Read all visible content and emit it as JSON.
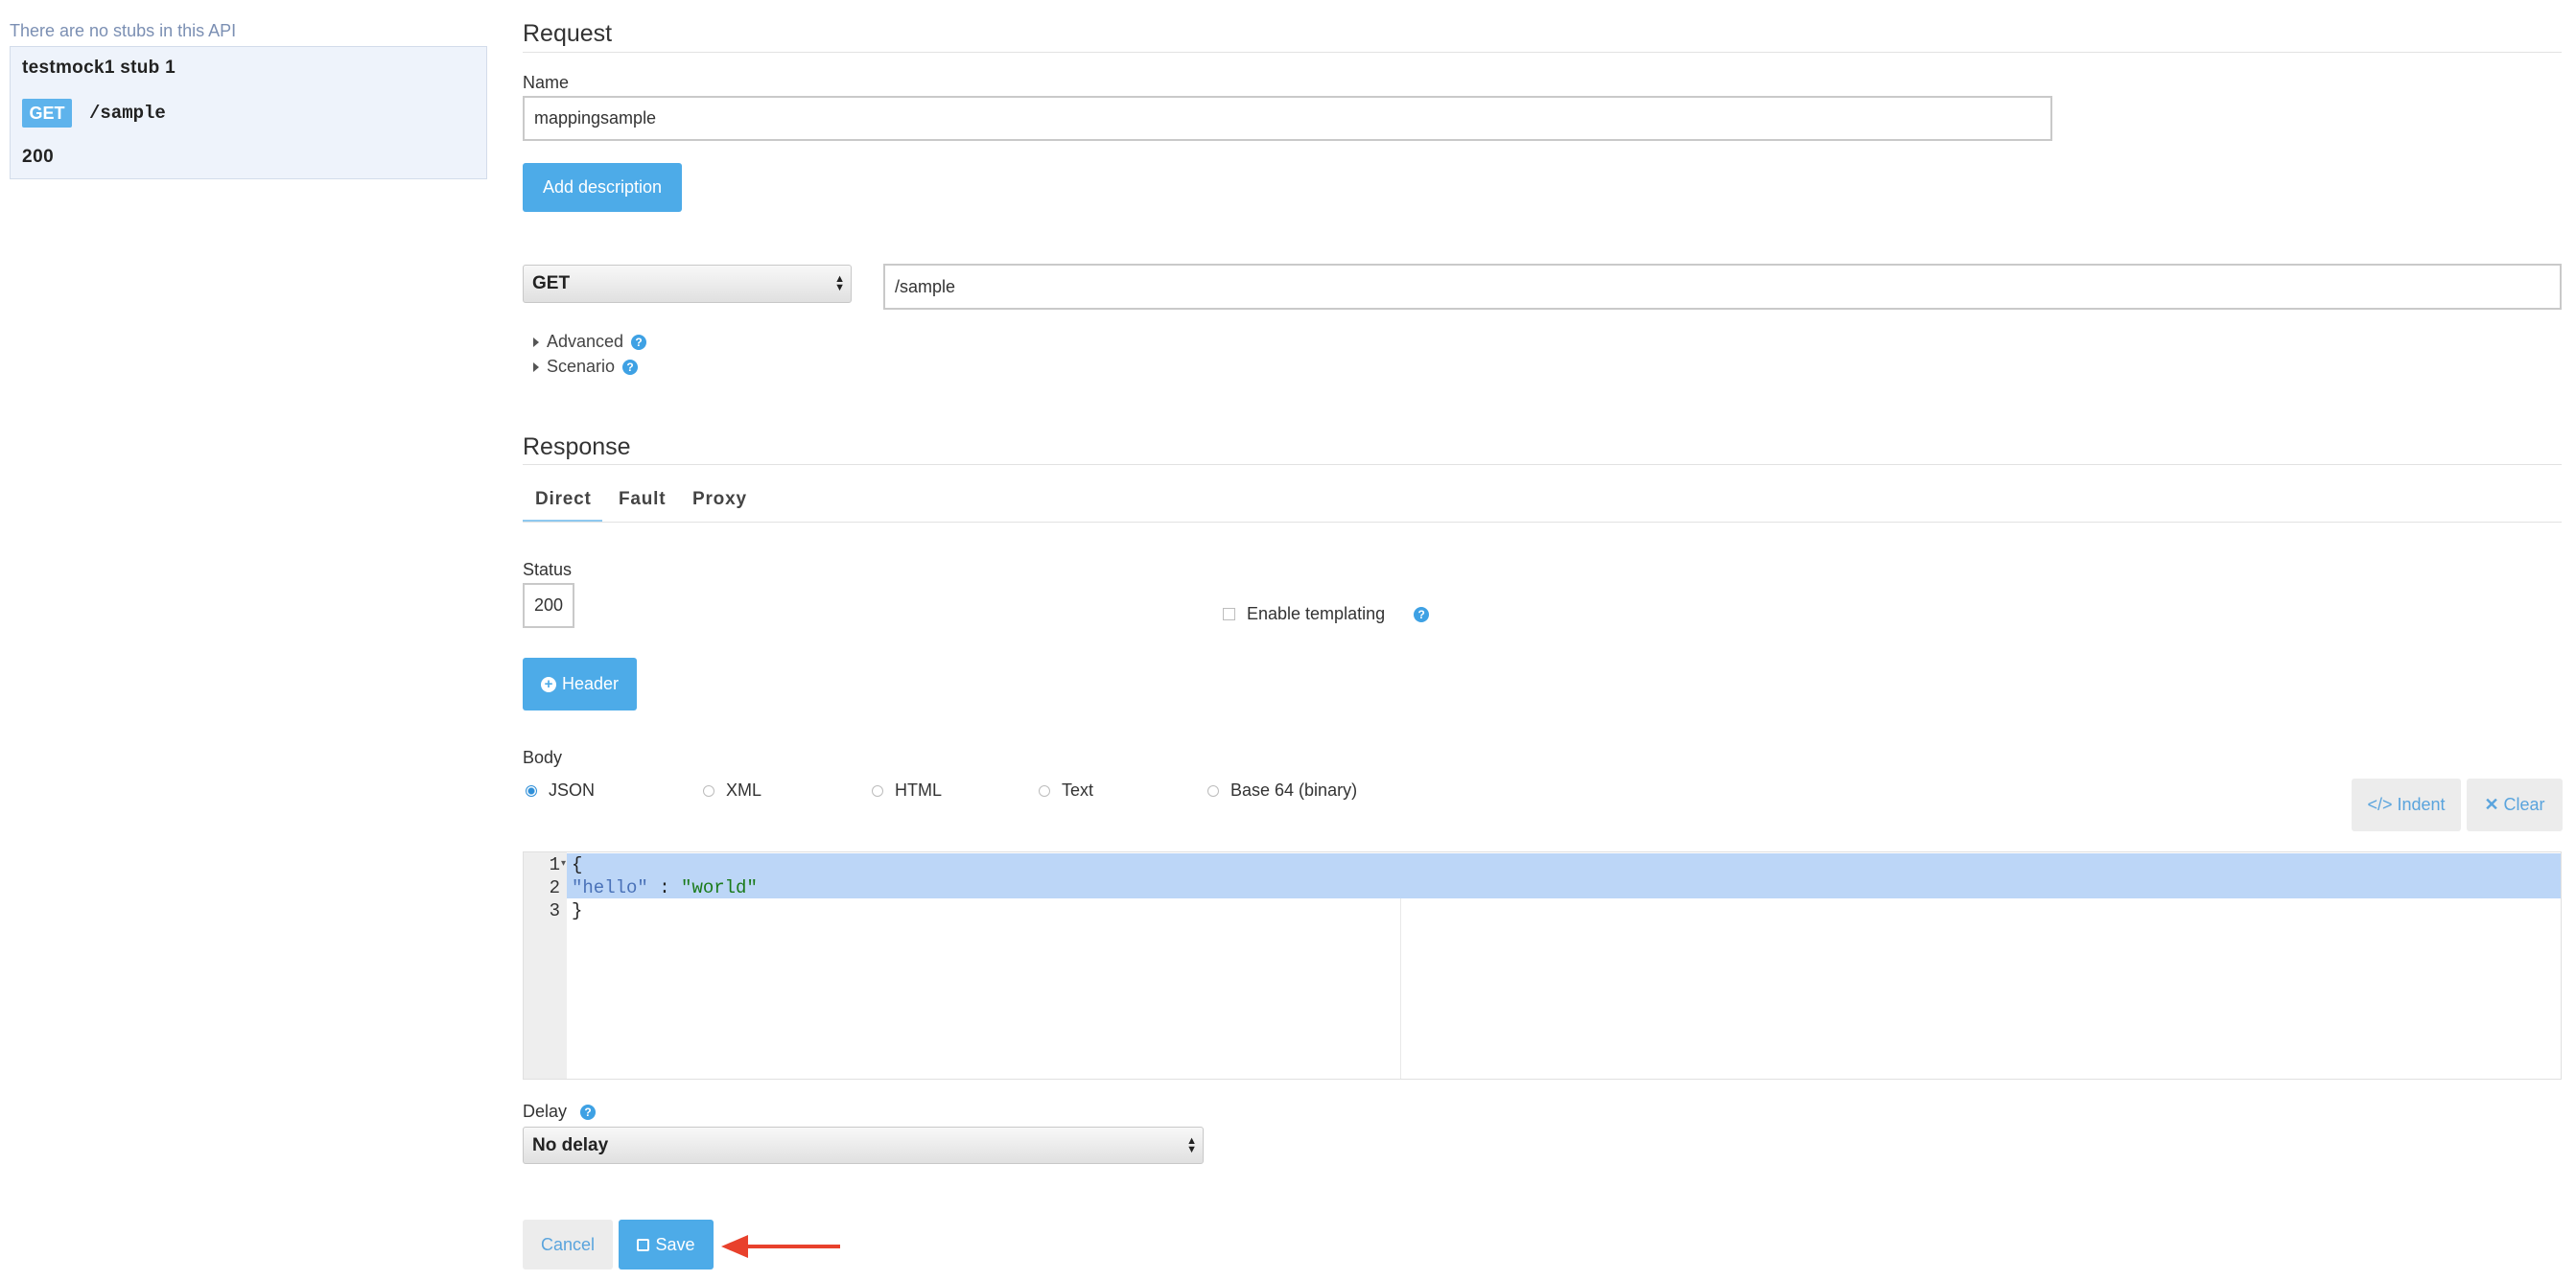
{
  "sidebar": {
    "message": "There are no stubs in this API",
    "stub": {
      "name": "testmock1 stub 1",
      "method": "GET",
      "url": "/sample",
      "status": "200"
    }
  },
  "request": {
    "title": "Request",
    "name_label": "Name",
    "name_value": "mappingsample",
    "add_description": "Add description",
    "method": "GET",
    "url": "/sample",
    "advanced": "Advanced",
    "scenario": "Scenario"
  },
  "response": {
    "title": "Response",
    "tabs": [
      "Direct",
      "Fault",
      "Proxy"
    ],
    "active_tab": "Direct",
    "status_label": "Status",
    "status_value": "200",
    "enable_templating": "Enable templating",
    "header_button": "Header",
    "body_label": "Body",
    "body_formats": [
      "JSON",
      "XML",
      "HTML",
      "Text",
      "Base 64 (binary)"
    ],
    "selected_format": "JSON",
    "indent_button": "Indent",
    "clear_button": "Clear",
    "editor": {
      "line_numbers": [
        "1",
        "2",
        "3"
      ],
      "lines": [
        "{",
        "\"hello\" : \"world\"",
        "}"
      ]
    },
    "delay_label": "Delay",
    "delay_value": "No delay"
  },
  "actions": {
    "cancel": "Cancel",
    "save": "Save"
  },
  "colors": {
    "accent": "#4dabe8",
    "arrow": "#e8412c",
    "selection": "#bcd6f7"
  }
}
